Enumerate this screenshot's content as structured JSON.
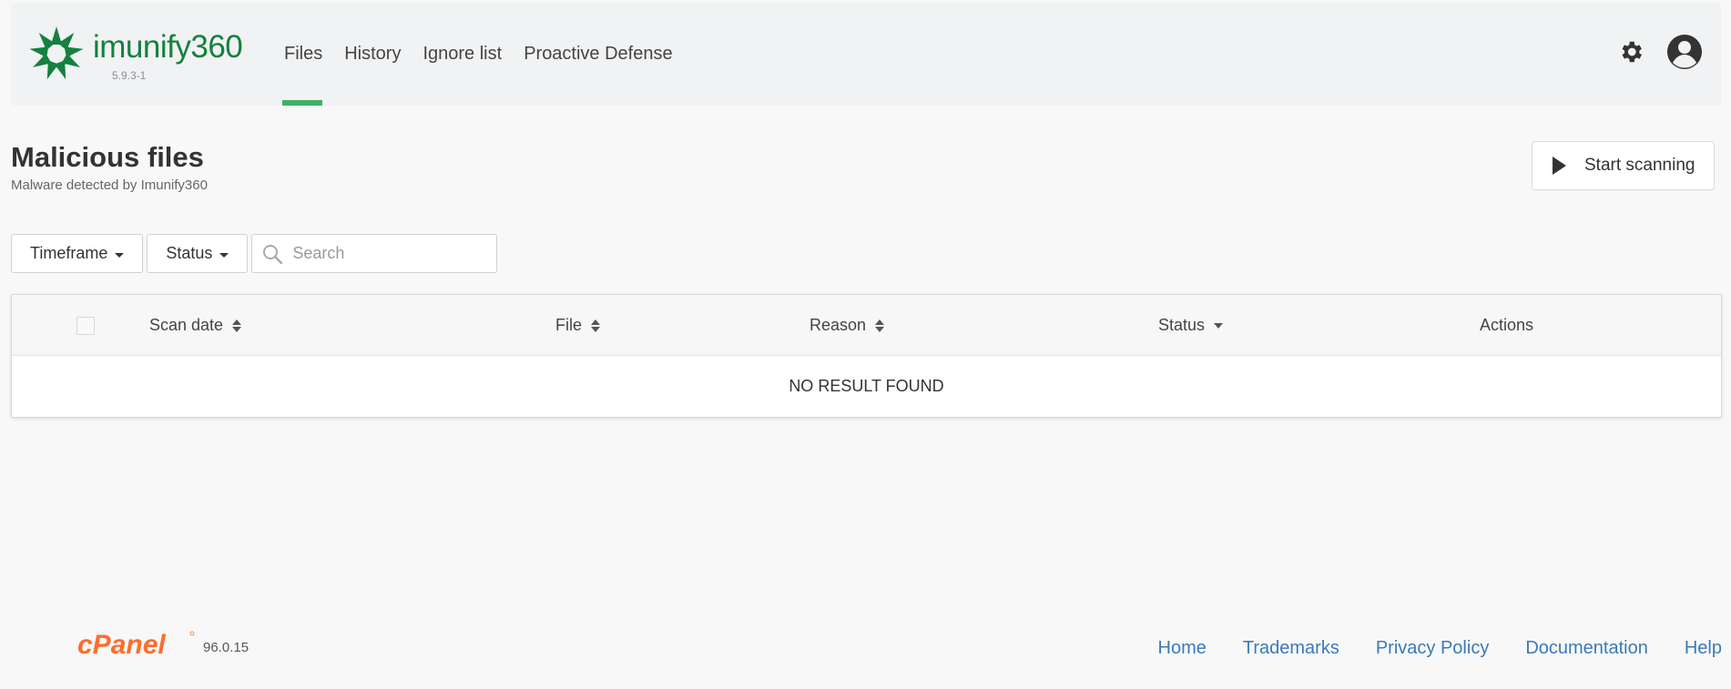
{
  "brand": {
    "name": "imunify360",
    "version": "5.9.3-1",
    "logo_color": "#14813f"
  },
  "nav": {
    "items": [
      {
        "label": "Files",
        "active": true
      },
      {
        "label": "History",
        "active": false
      },
      {
        "label": "Ignore list",
        "active": false
      },
      {
        "label": "Proactive Defense",
        "active": false
      }
    ],
    "active_color": "#3eb065"
  },
  "header_icons": [
    "gear-icon",
    "user-avatar-icon"
  ],
  "page": {
    "title": "Malicious files",
    "subtitle": "Malware detected by Imunify360"
  },
  "actions": {
    "start_scanning": "Start scanning"
  },
  "filters": {
    "timeframe": "Timeframe",
    "status": "Status",
    "search_placeholder": "Search"
  },
  "table": {
    "columns": [
      {
        "label": "Scan date",
        "sort": "both"
      },
      {
        "label": "File",
        "sort": "both"
      },
      {
        "label": "Reason",
        "sort": "both"
      },
      {
        "label": "Status",
        "sort": "down"
      },
      {
        "label": "Actions",
        "sort": "none"
      }
    ],
    "empty_message": "NO RESULT FOUND"
  },
  "footer": {
    "cpanel_brand": "cPanel",
    "cpanel_version": "96.0.15",
    "brand_color": "#ff6c2c",
    "links": [
      "Home",
      "Trademarks",
      "Privacy Policy",
      "Documentation",
      "Help"
    ]
  }
}
